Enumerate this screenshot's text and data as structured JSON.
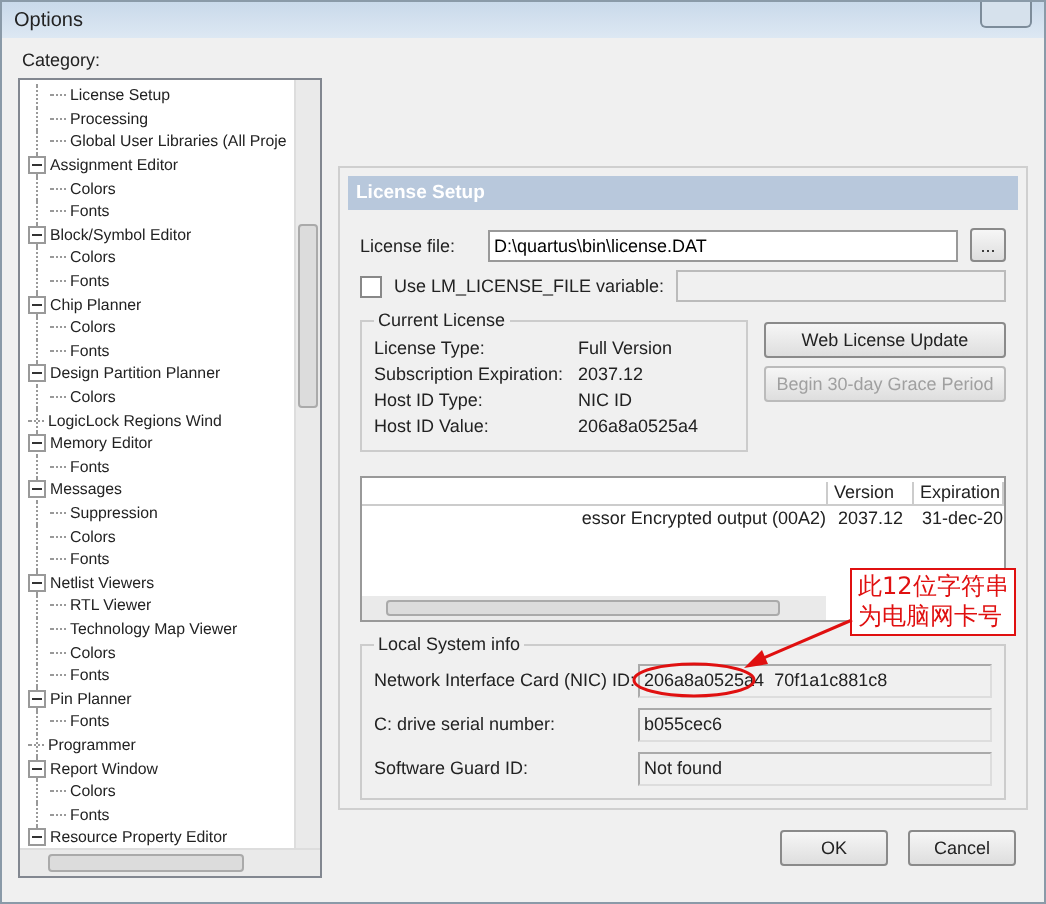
{
  "window": {
    "title": "Options"
  },
  "category": {
    "label": "Category:",
    "tree": [
      {
        "children": [
          {
            "label": "License Setup"
          },
          {
            "label": "Processing"
          },
          {
            "label": "Global User Libraries (All Proje"
          }
        ]
      },
      {
        "label": "Assignment Editor",
        "expanded": true,
        "children": [
          {
            "label": "Colors"
          },
          {
            "label": "Fonts"
          }
        ]
      },
      {
        "label": "Block/Symbol Editor",
        "expanded": true,
        "children": [
          {
            "label": "Colors"
          },
          {
            "label": "Fonts"
          }
        ]
      },
      {
        "label": "Chip Planner",
        "expanded": true,
        "children": [
          {
            "label": "Colors"
          },
          {
            "label": "Fonts"
          }
        ]
      },
      {
        "label": "Design Partition Planner",
        "expanded": true,
        "children": [
          {
            "label": "Colors"
          }
        ]
      },
      {
        "label": "LogicLock Regions Wind"
      },
      {
        "label": "Memory Editor",
        "expanded": true,
        "children": [
          {
            "label": "Fonts"
          }
        ]
      },
      {
        "label": "Messages",
        "expanded": true,
        "children": [
          {
            "label": "Suppression"
          },
          {
            "label": "Colors"
          },
          {
            "label": "Fonts"
          }
        ]
      },
      {
        "label": "Netlist Viewers",
        "expanded": true,
        "children": [
          {
            "label": "RTL Viewer"
          },
          {
            "label": "Technology Map Viewer"
          },
          {
            "label": "Colors"
          },
          {
            "label": "Fonts"
          }
        ]
      },
      {
        "label": "Pin Planner",
        "expanded": true,
        "children": [
          {
            "label": "Fonts"
          }
        ]
      },
      {
        "label": "Programmer"
      },
      {
        "label": "Report Window",
        "expanded": true,
        "children": [
          {
            "label": "Colors"
          },
          {
            "label": "Fonts"
          }
        ]
      },
      {
        "label": "Resource Property Editor",
        "expanded": true
      }
    ]
  },
  "panel": {
    "title": "License Setup",
    "license_file": {
      "label": "License file:",
      "value": "D:\\quartus\\bin\\license.DAT",
      "browse": "..."
    },
    "lm_variable": {
      "label": "Use LM_LICENSE_FILE variable:",
      "checked": false
    },
    "current_license": {
      "title": "Current License",
      "rows": [
        {
          "label": "License Type:",
          "value": "Full Version"
        },
        {
          "label": "Subscription Expiration:",
          "value": "2037.12"
        },
        {
          "label": "Host ID Type:",
          "value": "NIC ID"
        },
        {
          "label": "Host ID Value:",
          "value": "206a8a0525a4"
        }
      ]
    },
    "buttons": [
      {
        "label": "Web License Update",
        "disabled": false
      },
      {
        "label": "Begin 30-day Grace Period",
        "disabled": true
      }
    ],
    "table": {
      "columns": [
        "",
        "Version",
        "Expiration"
      ],
      "rows": [
        [
          "essor Encrypted output (00A2)",
          "2037.12",
          "31-dec-20"
        ]
      ]
    },
    "local_system": {
      "title": "Local System info",
      "rows": [
        {
          "label": "Network Interface Card (NIC) ID:",
          "value": "206a8a0525a4  70f1a1c881c8"
        },
        {
          "label": "C: drive serial number:",
          "value": "b055cec6"
        },
        {
          "label": "Software Guard ID:",
          "value": "Not found"
        }
      ]
    }
  },
  "annotation": {
    "lines": [
      "此12位字符串",
      "为电脑网卡号"
    ]
  },
  "buttons": [
    "OK",
    "Cancel"
  ]
}
